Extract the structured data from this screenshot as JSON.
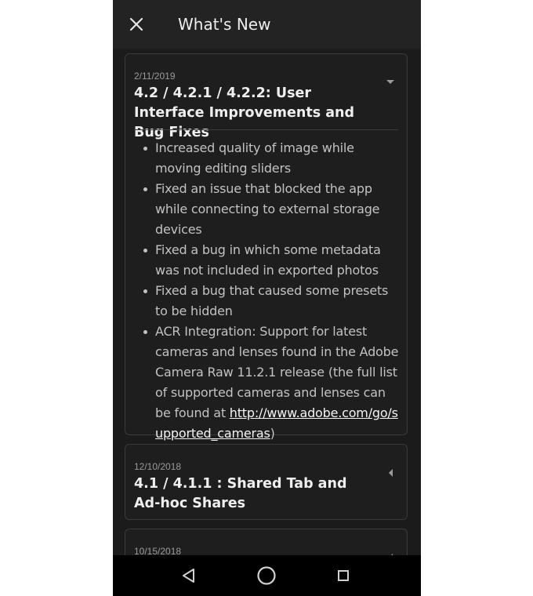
{
  "header": {
    "title": "What's New",
    "close_icon": "close-icon"
  },
  "releases": [
    {
      "date": "2/11/2019",
      "title": "4.2 / 4.2.1 / 4.2.2: User Interface Improvements and Bug Fixes",
      "expanded": true,
      "notes": [
        "Increased quality of image while moving editing sliders",
        "Fixed an issue that blocked the app while connecting to external storage devices",
        "Fixed a bug in which some metadata was not included in exported photos",
        "Fixed a bug that caused some presets to be hidden"
      ],
      "acr_note": {
        "text": "ACR Integration: Support for latest cameras and lenses found in the Adobe Camera Raw 11.2.1 release (the full list of supported cameras and lenses can be found at ",
        "link": "http://www.adobe.com/go/supported_cameras",
        "suffix": ")"
      }
    },
    {
      "date": "12/10/2018",
      "title": "4.1 / 4.1.1 : Shared Tab and Ad-hoc Shares",
      "expanded": false
    },
    {
      "date": "10/15/2018",
      "title": "",
      "expanded": false
    }
  ],
  "system_nav": {
    "back_icon": "back-triangle-icon",
    "home_icon": "home-circle-icon",
    "recents_icon": "recents-square-icon"
  },
  "colors": {
    "background": "#1b1b1b",
    "card": "#1e1e1e",
    "card_border": "#3a3a3a",
    "title_text": "#efefef",
    "body_text": "#c2c2c2",
    "date_text": "#9a9a9a",
    "nav_bar": "#000000"
  }
}
